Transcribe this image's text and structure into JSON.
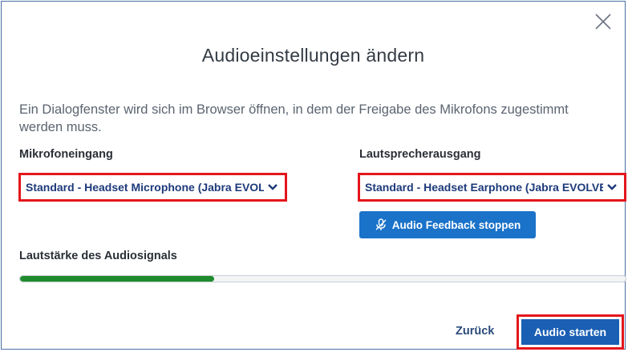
{
  "dialog": {
    "title": "Audioeinstellungen ändern",
    "description": "Ein Dialogfenster wird sich im Browser öffnen, in dem der Freigabe des Mikrofons zugestimmt werden muss.",
    "close_icon": "close-icon"
  },
  "microphone": {
    "label": "Mikrofoneingang",
    "selected": "Standard - Headset Microphone (Jabra EVOLVE"
  },
  "speaker": {
    "label": "Lautsprecherausgang",
    "selected": "Standard - Headset Earphone (Jabra EVOLVE"
  },
  "feedback_button": {
    "label": "Audio Feedback stoppen",
    "icon": "microphone-off-icon"
  },
  "volume": {
    "label": "Lautstärke des Audiosignals",
    "level": 0.32
  },
  "footer": {
    "back_label": "Zurück",
    "start_label": "Audio starten"
  },
  "colors": {
    "accent": "#1a5fb4",
    "highlight": "#e3161b",
    "volume_fill": "#1f8b2e"
  }
}
